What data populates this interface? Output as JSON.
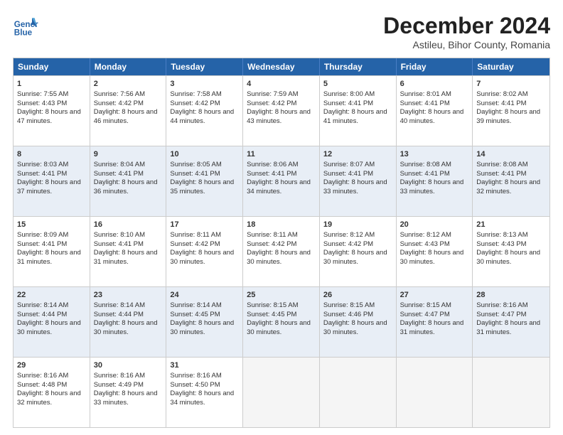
{
  "header": {
    "logo_line1": "General",
    "logo_line2": "Blue",
    "main_title": "December 2024",
    "subtitle": "Astileu, Bihor County, Romania"
  },
  "days": [
    "Sunday",
    "Monday",
    "Tuesday",
    "Wednesday",
    "Thursday",
    "Friday",
    "Saturday"
  ],
  "rows": [
    [
      {
        "day": "1",
        "rise": "7:55 AM",
        "set": "4:43 PM",
        "hours": "8 hours and 47 minutes."
      },
      {
        "day": "2",
        "rise": "7:56 AM",
        "set": "4:42 PM",
        "hours": "8 hours and 46 minutes."
      },
      {
        "day": "3",
        "rise": "7:58 AM",
        "set": "4:42 PM",
        "hours": "8 hours and 44 minutes."
      },
      {
        "day": "4",
        "rise": "7:59 AM",
        "set": "4:42 PM",
        "hours": "8 hours and 43 minutes."
      },
      {
        "day": "5",
        "rise": "8:00 AM",
        "set": "4:41 PM",
        "hours": "8 hours and 41 minutes."
      },
      {
        "day": "6",
        "rise": "8:01 AM",
        "set": "4:41 PM",
        "hours": "8 hours and 40 minutes."
      },
      {
        "day": "7",
        "rise": "8:02 AM",
        "set": "4:41 PM",
        "hours": "8 hours and 39 minutes."
      }
    ],
    [
      {
        "day": "8",
        "rise": "8:03 AM",
        "set": "4:41 PM",
        "hours": "8 hours and 37 minutes."
      },
      {
        "day": "9",
        "rise": "8:04 AM",
        "set": "4:41 PM",
        "hours": "8 hours and 36 minutes."
      },
      {
        "day": "10",
        "rise": "8:05 AM",
        "set": "4:41 PM",
        "hours": "8 hours and 35 minutes."
      },
      {
        "day": "11",
        "rise": "8:06 AM",
        "set": "4:41 PM",
        "hours": "8 hours and 34 minutes."
      },
      {
        "day": "12",
        "rise": "8:07 AM",
        "set": "4:41 PM",
        "hours": "8 hours and 33 minutes."
      },
      {
        "day": "13",
        "rise": "8:08 AM",
        "set": "4:41 PM",
        "hours": "8 hours and 33 minutes."
      },
      {
        "day": "14",
        "rise": "8:08 AM",
        "set": "4:41 PM",
        "hours": "8 hours and 32 minutes."
      }
    ],
    [
      {
        "day": "15",
        "rise": "8:09 AM",
        "set": "4:41 PM",
        "hours": "8 hours and 31 minutes."
      },
      {
        "day": "16",
        "rise": "8:10 AM",
        "set": "4:41 PM",
        "hours": "8 hours and 31 minutes."
      },
      {
        "day": "17",
        "rise": "8:11 AM",
        "set": "4:42 PM",
        "hours": "8 hours and 30 minutes."
      },
      {
        "day": "18",
        "rise": "8:11 AM",
        "set": "4:42 PM",
        "hours": "8 hours and 30 minutes."
      },
      {
        "day": "19",
        "rise": "8:12 AM",
        "set": "4:42 PM",
        "hours": "8 hours and 30 minutes."
      },
      {
        "day": "20",
        "rise": "8:12 AM",
        "set": "4:43 PM",
        "hours": "8 hours and 30 minutes."
      },
      {
        "day": "21",
        "rise": "8:13 AM",
        "set": "4:43 PM",
        "hours": "8 hours and 30 minutes."
      }
    ],
    [
      {
        "day": "22",
        "rise": "8:14 AM",
        "set": "4:44 PM",
        "hours": "8 hours and 30 minutes."
      },
      {
        "day": "23",
        "rise": "8:14 AM",
        "set": "4:44 PM",
        "hours": "8 hours and 30 minutes."
      },
      {
        "day": "24",
        "rise": "8:14 AM",
        "set": "4:45 PM",
        "hours": "8 hours and 30 minutes."
      },
      {
        "day": "25",
        "rise": "8:15 AM",
        "set": "4:45 PM",
        "hours": "8 hours and 30 minutes."
      },
      {
        "day": "26",
        "rise": "8:15 AM",
        "set": "4:46 PM",
        "hours": "8 hours and 30 minutes."
      },
      {
        "day": "27",
        "rise": "8:15 AM",
        "set": "4:47 PM",
        "hours": "8 hours and 31 minutes."
      },
      {
        "day": "28",
        "rise": "8:16 AM",
        "set": "4:47 PM",
        "hours": "8 hours and 31 minutes."
      }
    ],
    [
      {
        "day": "29",
        "rise": "8:16 AM",
        "set": "4:48 PM",
        "hours": "8 hours and 32 minutes."
      },
      {
        "day": "30",
        "rise": "8:16 AM",
        "set": "4:49 PM",
        "hours": "8 hours and 33 minutes."
      },
      {
        "day": "31",
        "rise": "8:16 AM",
        "set": "4:50 PM",
        "hours": "8 hours and 34 minutes."
      },
      null,
      null,
      null,
      null
    ]
  ]
}
